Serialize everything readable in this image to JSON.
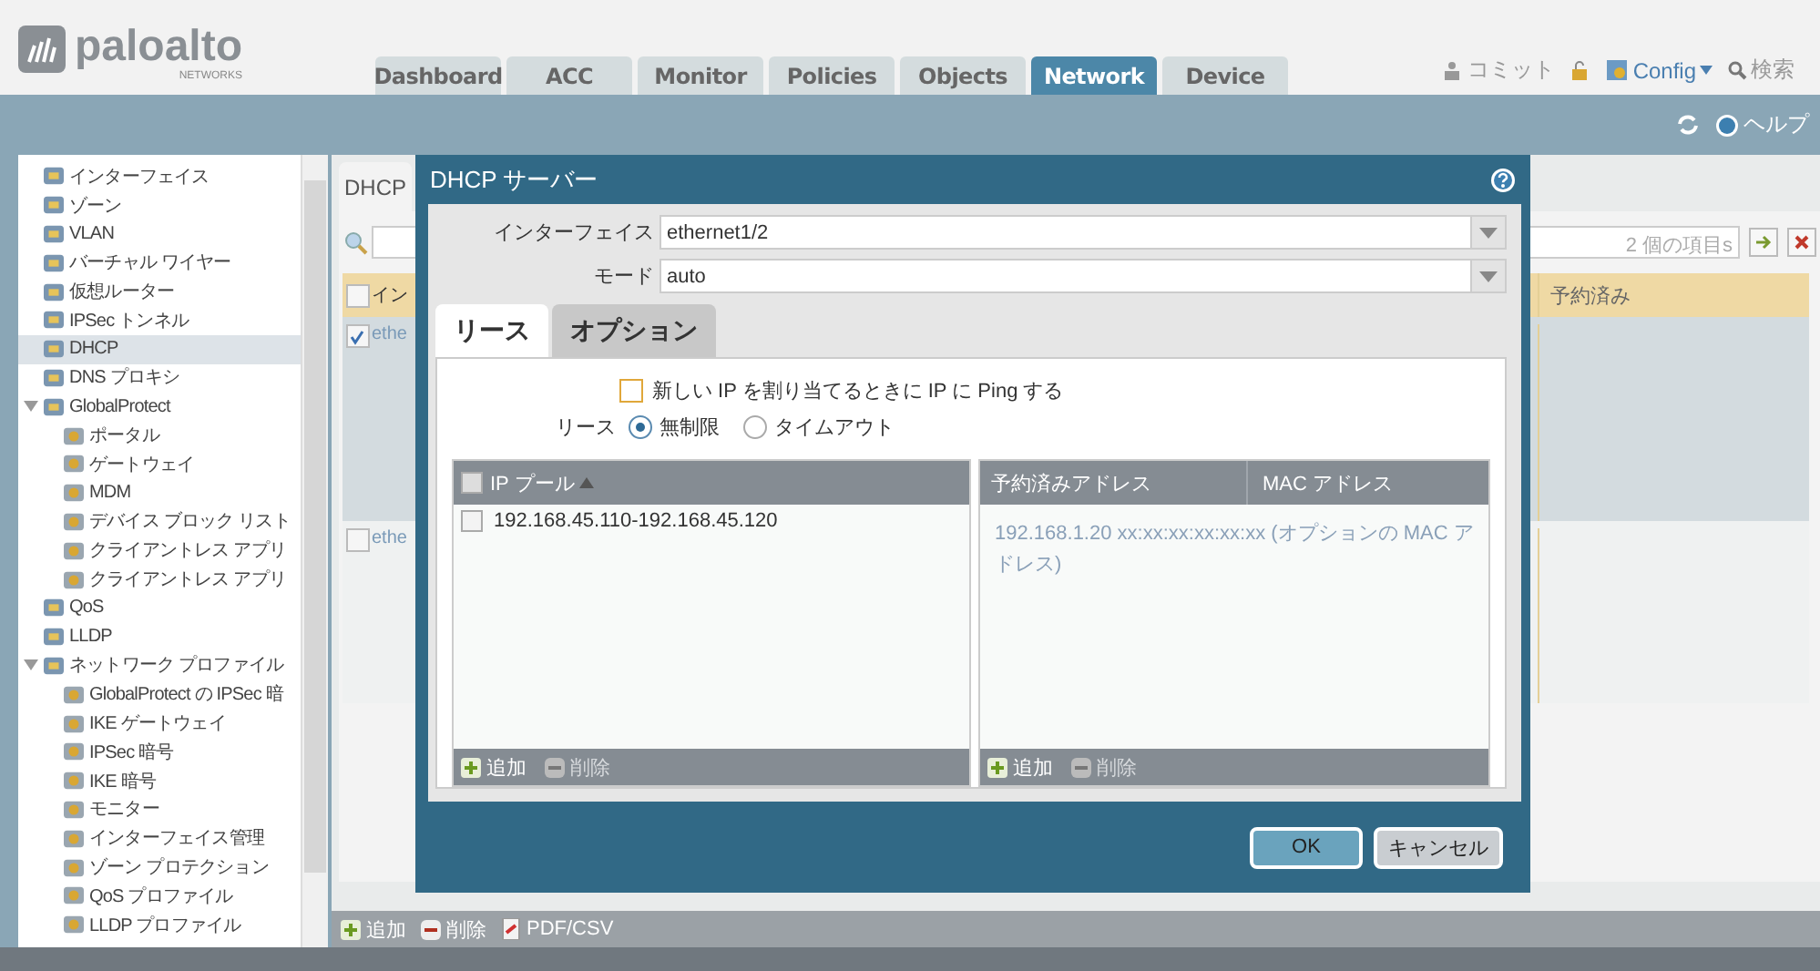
{
  "header": {
    "logo": {
      "name": "paloalto",
      "sub": "NETWORKS"
    },
    "tabs": [
      {
        "label": "Dashboard",
        "selected": false
      },
      {
        "label": "ACC",
        "selected": false
      },
      {
        "label": "Monitor",
        "selected": false
      },
      {
        "label": "Policies",
        "selected": false
      },
      {
        "label": "Objects",
        "selected": false
      },
      {
        "label": "Network",
        "selected": true
      },
      {
        "label": "Device",
        "selected": false
      }
    ],
    "actions": [
      {
        "kind": "commit",
        "label": "コミット"
      },
      {
        "kind": "lock"
      },
      {
        "kind": "config",
        "label": "Config"
      },
      {
        "kind": "search",
        "label": "検索"
      }
    ]
  },
  "subbar": {
    "help": "ヘルプ"
  },
  "sidebar": {
    "items": [
      {
        "label": "インターフェイス",
        "selected": false
      },
      {
        "label": "ゾーン",
        "selected": false
      },
      {
        "label": "VLAN",
        "selected": false
      },
      {
        "label": "バーチャル ワイヤー",
        "selected": false
      },
      {
        "label": "仮想ルーター",
        "selected": false
      },
      {
        "label": "IPSec トンネル",
        "selected": false
      },
      {
        "label": "DHCP",
        "selected": true
      },
      {
        "label": "DNS プロキシ",
        "selected": false
      },
      {
        "label": "GlobalProtect",
        "selected": false,
        "expanded": true,
        "children": [
          {
            "label": "ポータル",
            "selected": false
          },
          {
            "label": "ゲートウェイ",
            "selected": false
          },
          {
            "label": "MDM",
            "selected": false
          },
          {
            "label": "デバイス ブロック リスト",
            "selected": false
          },
          {
            "label": "クライアントレス アプリ",
            "selected": false
          },
          {
            "label": "クライアントレス アプリ",
            "selected": false
          }
        ]
      },
      {
        "label": "QoS",
        "selected": false
      },
      {
        "label": "LLDP",
        "selected": false
      },
      {
        "label": "ネットワーク プロファイル",
        "selected": false,
        "expanded": true,
        "children": [
          {
            "label": "GlobalProtect の IPSec 暗",
            "selected": false
          },
          {
            "label": "IKE ゲートウェイ",
            "selected": false
          },
          {
            "label": "IPSec 暗号",
            "selected": false
          },
          {
            "label": "IKE 暗号",
            "selected": false
          },
          {
            "label": "モニター",
            "selected": false
          },
          {
            "label": "インターフェイス管理",
            "selected": false
          },
          {
            "label": "ゾーン プロテクション",
            "selected": false
          },
          {
            "label": "QoS プロファイル",
            "selected": false
          },
          {
            "label": "LLDP プロファイル",
            "selected": false
          }
        ]
      }
    ]
  },
  "main": {
    "tab": "DHCP",
    "search": {
      "count": "2 個の項目s"
    },
    "table": {
      "all_checked": false,
      "columns": [
        "イン",
        "予約済み"
      ],
      "rows": [
        {
          "cell": "ethe",
          "checked": true
        },
        {
          "cell": "ethe",
          "checked": false
        }
      ]
    },
    "toolbar": [
      {
        "kind": "add",
        "label": "追加"
      },
      {
        "kind": "delete",
        "label": "削除"
      },
      {
        "kind": "export",
        "label": "PDF/CSV"
      }
    ]
  },
  "dialog": {
    "title": "DHCP サーバー",
    "fields": [
      {
        "label": "インターフェイス",
        "value": "ethernet1/2"
      },
      {
        "label": "モード",
        "value": "auto"
      }
    ],
    "tabs": [
      {
        "label": "リース",
        "selected": true
      },
      {
        "label": "オプション",
        "selected": false
      }
    ],
    "ping_option": {
      "label": "新しい IP を割り当てるときに IP に Ping する",
      "checked": false
    },
    "lease": {
      "label": "リース",
      "options": [
        {
          "label": "無制限",
          "selected": true
        },
        {
          "label": "タイムアウト",
          "selected": false
        }
      ]
    },
    "ip_pool": {
      "all_checked": false,
      "column": "IP プール",
      "rows": [
        {
          "value": "192.168.45.110-192.168.45.120",
          "checked": false
        }
      ],
      "toolbar": [
        {
          "kind": "add",
          "label": "追加",
          "disabled": false
        },
        {
          "kind": "delete",
          "label": "削除",
          "disabled": true
        }
      ]
    },
    "reserved": {
      "columns": [
        "予約済みアドレス",
        "MAC アドレス"
      ],
      "hint": "192.168.1.20 xx:xx:xx:xx:xx:xx (オプションの MAC アドレス)",
      "toolbar": [
        {
          "kind": "add",
          "label": "追加",
          "disabled": false
        },
        {
          "kind": "delete",
          "label": "削除",
          "disabled": true
        }
      ]
    },
    "buttons": [
      {
        "label": "OK",
        "kind": "primary"
      },
      {
        "label": "キャンセル",
        "kind": "secondary"
      }
    ]
  }
}
